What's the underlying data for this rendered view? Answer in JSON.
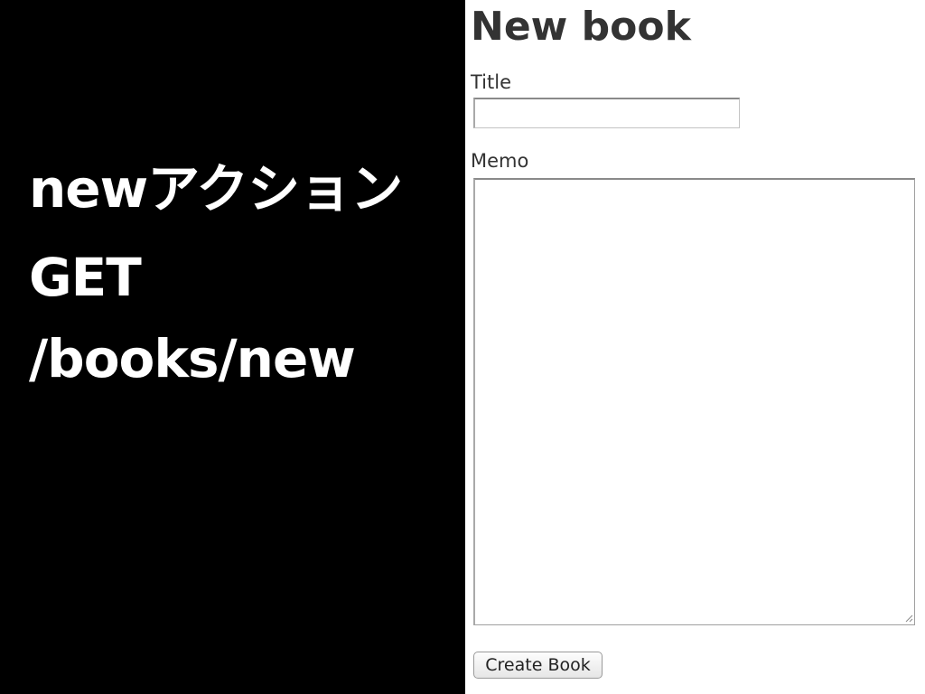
{
  "slide": {
    "lines": [
      "newアクション",
      "GET",
      "/books/new"
    ]
  },
  "form": {
    "heading": "New book",
    "title_label": "Title",
    "title_value": "",
    "memo_label": "Memo",
    "memo_value": "",
    "submit_label": "Create Book"
  },
  "colors": {
    "slide_background": "#000000",
    "slide_text": "#ffffff",
    "page_background": "#ffffff",
    "form_text": "#333333"
  },
  "icons": {
    "resize_grip": "resize-grip-icon"
  }
}
